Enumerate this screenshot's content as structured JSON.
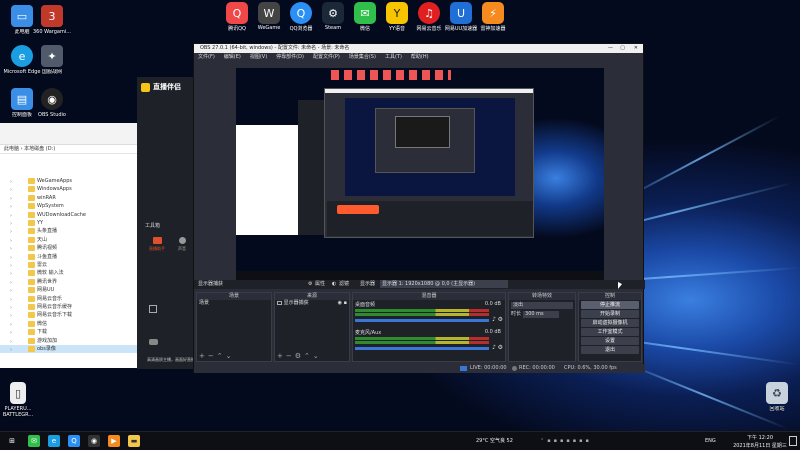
{
  "desktop_icons_left": [
    {
      "label": "此电脑",
      "icon": "computer-icon",
      "color": "#3a8ee6"
    },
    {
      "label": "360 Wargami...",
      "icon": "360-icon",
      "color": "#c0392b"
    },
    {
      "label": "Microsoft Edge",
      "icon": "edge-icon",
      "color": "#1b9de2"
    },
    {
      "label": "国服战网",
      "icon": "battlenet-icon",
      "color": "#505a6b"
    },
    {
      "label": "控制面板",
      "icon": "control-panel-icon",
      "color": "#3a8ee6"
    },
    {
      "label": "OBS Studio",
      "icon": "obs-icon",
      "color": "#333333"
    },
    {
      "label": "PLAYERU... BATTLEGR...",
      "icon": "file-icon",
      "color": "#eeeeee"
    }
  ],
  "desktop_icons_top": [
    {
      "label": "腾讯QQ",
      "icon": "qq-icon",
      "color": "#f04848"
    },
    {
      "label": "WeGame",
      "icon": "wegame-icon",
      "color": "#444444"
    },
    {
      "label": "QQ浏览器",
      "icon": "qq-browser-icon",
      "color": "#2b8ff3"
    },
    {
      "label": "Steam",
      "icon": "steam-icon",
      "color": "#1b2838"
    },
    {
      "label": "微信",
      "icon": "wechat-icon",
      "color": "#2fbf4a"
    },
    {
      "label": "YY语音",
      "icon": "yy-icon",
      "color": "#f7c400"
    },
    {
      "label": "网易云音乐",
      "icon": "netease-music-icon",
      "color": "#e02020"
    },
    {
      "label": "网易UU加速器",
      "icon": "uu-icon",
      "color": "#1f6fd6"
    },
    {
      "label": "雷神加速器",
      "icon": "leishen-icon",
      "color": "#f58a1f"
    }
  ],
  "recycle_bin": {
    "label": "回收站"
  },
  "explorer": {
    "nav": "此电脑 › 本地磁盘 (D:)",
    "rows": [
      "WeGameApps",
      "WindowsApps",
      "winRAR",
      "WpSystem",
      "WUDownloadCache",
      "YY",
      "头条直播",
      "天山",
      "腾讯视频",
      "斗鱼直播",
      "雷云",
      "微软 输入法",
      "腾讯世界",
      "网易UU",
      "网易云音乐",
      "网易云音乐缓存",
      "网易云音乐下载",
      "微信",
      "下载",
      "游戏加加",
      "obs录像"
    ]
  },
  "zhibo": {
    "title": "直播伴侣",
    "tools_label": "工具箱",
    "item1": "直播助手",
    "item2": "声音",
    "btn_label": "开始直播",
    "notice": "高清画质主播，画面好直播"
  },
  "obs": {
    "title": "OBS 27.0.1 (64-bit, windows) - 配置文件: 未命名 - 场景: 未命名",
    "menu": [
      "文件(F)",
      "编辑(E)",
      "视图(V)",
      "停靠部件(D)",
      "配置文件(P)",
      "场景集合(S)",
      "工具(T)",
      "帮助(H)"
    ],
    "ctrlbar": {
      "source_label": "显示器捕获",
      "props": "属性",
      "filters": "滤镜",
      "display_label": "显示器",
      "display_value": "显示器 1: 1920x1080 @ 0,0 (主显示器)"
    },
    "scenes": {
      "title": "场景",
      "items": [
        "场景"
      ]
    },
    "sources": {
      "title": "来源",
      "items": [
        "显示器捕获"
      ]
    },
    "mixer": {
      "title": "混音器",
      "tracks": [
        {
          "name": "桌面音频",
          "db": "0.0 dB",
          "level": 0.62
        },
        {
          "name": "麦克风/Aux",
          "db": "0.0 dB",
          "level": 0.55
        }
      ]
    },
    "transitions": {
      "title": "转场特效",
      "type": "淡出",
      "duration_label": "时长",
      "duration": "300 ms"
    },
    "controls": {
      "title": "控制",
      "buttons": [
        "停止推流",
        "开始录制",
        "启动虚拟摄像机",
        "工作室模式",
        "设置",
        "退出"
      ]
    },
    "status": {
      "live": "LIVE: 00:00:00",
      "rec": "REC: 00:00:00",
      "cpu": "CPU: 0.6%, 30.00 fps"
    }
  },
  "taskbar": {
    "weather": "29°C 空气良 52",
    "ime": "ENG",
    "time": "下午 12:20",
    "date": "2021年8月11日 星期三"
  }
}
